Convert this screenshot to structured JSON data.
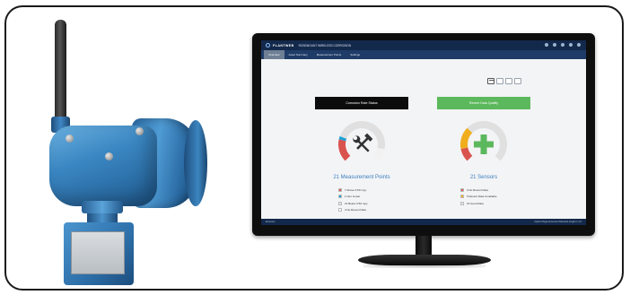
{
  "app": {
    "brand": "PLANTWEB",
    "name": "ROSEMOUNT WIRELESS CORROSION",
    "tabs": [
      "Overview",
      "Asset Summary",
      "Measurement Points",
      "Settings"
    ],
    "active_tab": "Overview",
    "footer_left": "Emerson",
    "footer_right": "Optics Plugin    Emerson Plantweb Insight 1.1.0"
  },
  "panels": {
    "corrosion": {
      "title": "Corrosion Rate Status",
      "caption": "21 Measurement Points",
      "legend": [
        {
          "label": "7 Above 3.50 mpy",
          "color": "#d9534f"
        },
        {
          "label": "1 Non Linear",
          "color": "#1ba1d4"
        },
        {
          "label": "21 Below 3.50 mpy",
          "color": "#e6e6e6"
        },
        {
          "label": "4 No Recent Data",
          "color": "#ffffff"
        }
      ],
      "gauge_segments": [
        {
          "name": "Above 3.50 mpy",
          "value": 7,
          "color": "#d9534f"
        },
        {
          "name": "Non Linear",
          "value": 1,
          "color": "#1ba1d4"
        },
        {
          "name": "Below 3.50 mpy",
          "value": 21,
          "color": "#e0e0e0"
        },
        {
          "name": "No Recent Data",
          "value": 4,
          "color": "#f2f2f2"
        }
      ],
      "icon": "tools-icon"
    },
    "quality": {
      "title": "Recent Data Quality",
      "caption": "21 Sensors",
      "legend": [
        {
          "label": "3 No Recent Data",
          "color": "#d9534f"
        },
        {
          "label": "5 Recent Data Unreliable",
          "color": "#f0ad1e"
        },
        {
          "label": "16 Good Data",
          "color": "#e6e6e6"
        }
      ],
      "gauge_segments": [
        {
          "name": "No Recent Data",
          "value": 3,
          "color": "#d9534f"
        },
        {
          "name": "Recent Data Unreliable",
          "value": 5,
          "color": "#f0ad1e"
        },
        {
          "name": "Good Data",
          "value": 16,
          "color": "#e0e0e0"
        }
      ],
      "icon": "plus-icon"
    }
  },
  "colors": {
    "header": "#13294b",
    "tabbar": "#1f3c68",
    "caption": "#3b7fbf",
    "quality_accent": "#5cb85c"
  }
}
